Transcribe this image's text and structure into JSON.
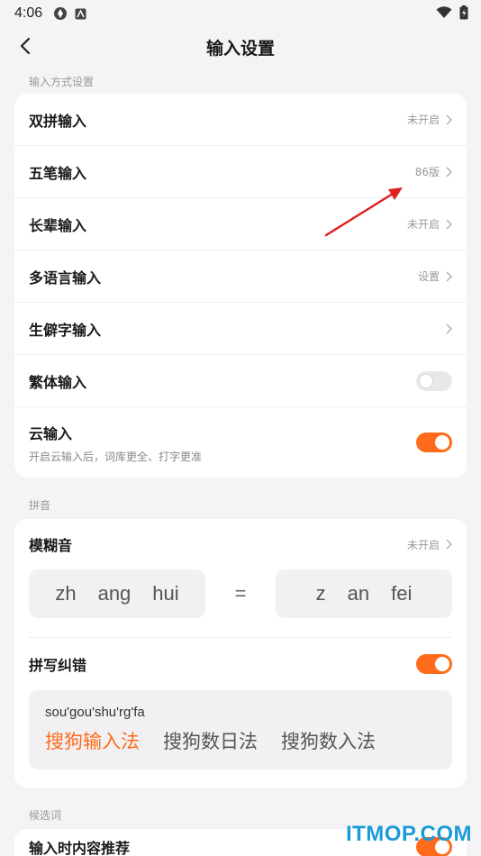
{
  "status_bar": {
    "time": "4:06"
  },
  "header": {
    "title": "输入设置"
  },
  "sections": {
    "input_methods": {
      "label": "输入方式设置",
      "rows": [
        {
          "label": "双拼输入",
          "value": "未开启"
        },
        {
          "label": "五笔输入",
          "value": "86版"
        },
        {
          "label": "长辈输入",
          "value": "未开启"
        },
        {
          "label": "多语言输入",
          "value": "设置"
        },
        {
          "label": "生僻字输入",
          "value": ""
        },
        {
          "label": "繁体输入",
          "toggle": false
        },
        {
          "label": "云输入",
          "sub": "开启云输入后，词库更全、打字更准",
          "toggle": true
        }
      ]
    },
    "pinyin": {
      "label": "拼音",
      "fuzzy": {
        "label": "模糊音",
        "value": "未开启",
        "left": [
          "zh",
          "ang",
          "hui"
        ],
        "equals": "=",
        "right": [
          "z",
          "an",
          "fei"
        ]
      },
      "correction": {
        "label": "拼写纠错",
        "toggle": true,
        "pinyin": "sou'gou'shu'rg'fa",
        "candidates": [
          "搜狗输入法",
          "搜狗数日法",
          "搜狗数入法"
        ]
      }
    },
    "candidates": {
      "label": "候选词",
      "row": {
        "label": "输入时内容推荐",
        "toggle": true
      }
    }
  },
  "watermark": "ITMOP.COM",
  "colors": {
    "accent": "#ff6b1a",
    "annotation": "#e02020"
  }
}
